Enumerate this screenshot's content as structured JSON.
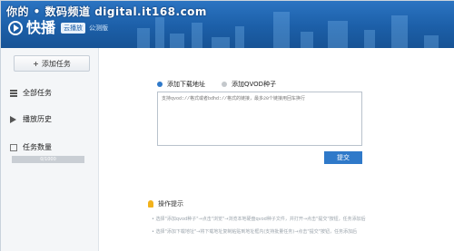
{
  "watermark": "你的 • 数码频道 digital.it168.com",
  "header": {
    "logo_text": "快播",
    "cloud_badge": "云播放",
    "beta_badge": "公测版"
  },
  "sidebar": {
    "add_task_label": "添加任务",
    "items": [
      {
        "label": "全部任务",
        "icon": "list-icon"
      },
      {
        "label": "播放历史",
        "icon": "play-icon"
      },
      {
        "label": "任务数量",
        "icon": "checkbox-icon"
      }
    ],
    "count_bar_text": "0/1000"
  },
  "main": {
    "radio_download_url": "添加下载地址",
    "radio_qvod_seed": "添加QVOD种子",
    "textarea_placeholder": "支持qvod://格式或者bdhd://格式的链接，最多20个链接用回车换行",
    "submit_label": "提交",
    "tips_title": "操作提示",
    "tips": [
      "• 选择\"添加qvod种子\"→点击\"浏览\"→浏览本地硬盘qvod种子文件，并打开→点击\"提交\"按钮，任务添加后",
      "• 选择\"添加下载地址\"→将下载地址复制粘贴到地址框内(支持批量任务)→点击\"提交\"按钮，任务添加后"
    ]
  },
  "colors": {
    "header_blue": "#1c5fa8",
    "accent_blue": "#2f79c9",
    "sidebar_bg": "#f4f6f8"
  }
}
